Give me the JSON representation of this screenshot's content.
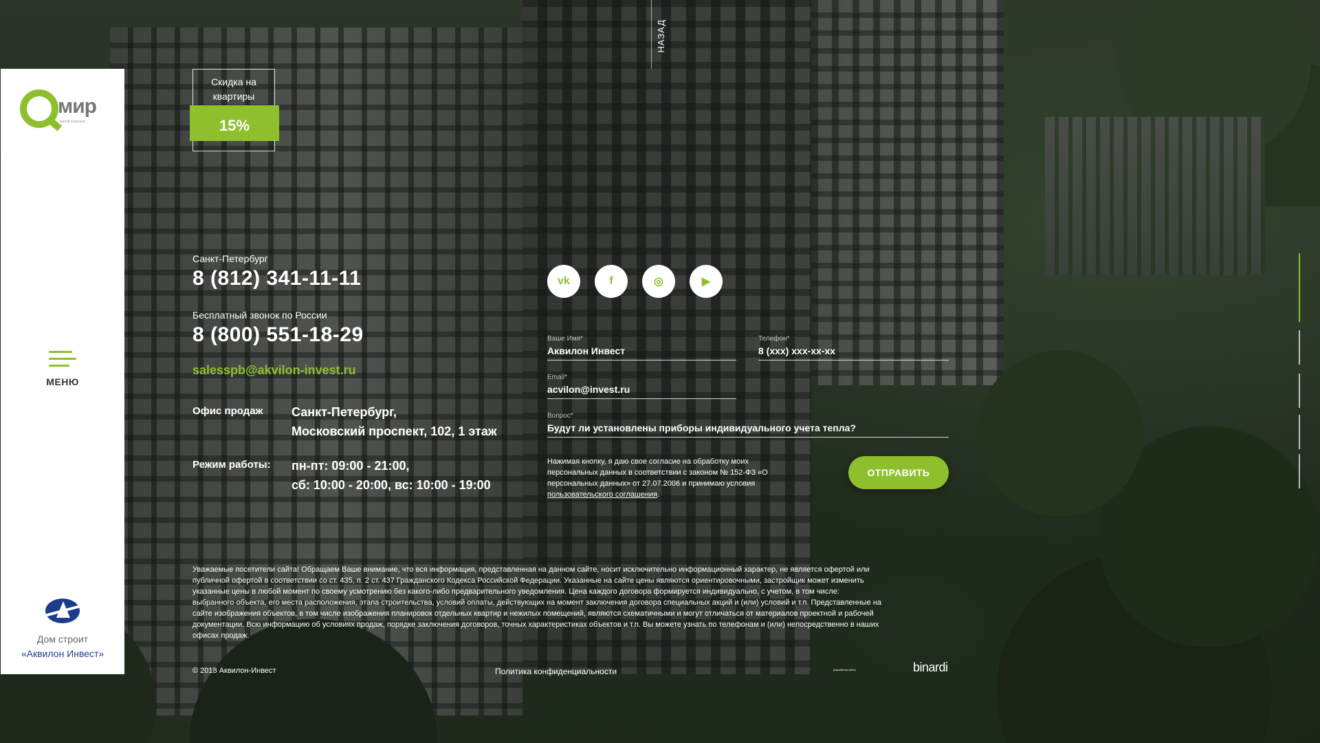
{
  "brand": {
    "logo_text": "мир",
    "logo_subtitle": "жилой комплекс"
  },
  "colors": {
    "accent": "#8ec02e",
    "sidebar_bg": "#ffffff",
    "builder_blue": "#1e3c8c"
  },
  "sidebar": {
    "menu_label": "МЕНЮ",
    "builder_line1": "Дом строит",
    "builder_line2": "«Аквилон Инвест»"
  },
  "discount": {
    "label": "Скидка на квартиры",
    "value": "15%"
  },
  "nav": {
    "back_label": "НАЗАД"
  },
  "contacts": {
    "city_label": "Санкт-Петербург",
    "phone_city": "8 (812) 341-11-11",
    "free_call_label": "Бесплатный звонок по России",
    "phone_free": "8 (800) 551-18-29",
    "email": "salesspb@akvilon-invest.ru",
    "office_label": "Офис продаж",
    "office_line1": "Санкт-Петербург,",
    "office_line2": "Московский проспект, 102, 1 этаж",
    "hours_label": "Режим работы:",
    "hours_line1": "пн-пт: 09:00 - 21:00,",
    "hours_line2": "сб: 10:00 - 20:00, вс: 10:00 - 19:00"
  },
  "social": [
    {
      "icon": "vk-icon",
      "glyph": "vk"
    },
    {
      "icon": "facebook-icon",
      "glyph": "f"
    },
    {
      "icon": "instagram-icon",
      "glyph": "◎"
    },
    {
      "icon": "youtube-icon",
      "glyph": "▶"
    }
  ],
  "form": {
    "name_label": "Ваше Имя*",
    "name_value": "Аквилон Инвест",
    "phone_label": "Телефон*",
    "phone_value": "8 (xxx) xxx-xx-xx",
    "email_label": "Email*",
    "email_value": "acvilon@invest.ru",
    "question_label": "Вопрос*",
    "question_value": "Будут ли установлены приборы индивидуального учета тепла?",
    "consent_text": "Нажимая кнопку, я даю свое согласие на обработку моих персональных данных в соответствии с законом № 152-ФЗ «О персональных данных» от 27.07.2006 и принимаю условия ",
    "consent_link": "пользовательского соглашения",
    "consent_tail": ".",
    "submit_label": "ОТПРАВИТЬ"
  },
  "footer": {
    "disclaimer": "Уважаемые посетители сайта! Обращаем Ваше внимание, что вся информация, представленная на данном сайте, носит исключительно информационный характер, не является офертой или публичной офертой в соответствии со ст. 435, п. 2 ст. 437 Гражданского Кодекса Российской Федерации. Указанные на сайте цены являются ориентировочными, застройщик может изменить указанные цены в любой момент по своему усмотрению без какого-либо предварительного уведомления. Цена каждого договора формируется индивидуально, с учетом, в том числе: выбранного объекта, его места расположения, этапа строительства, условий оплаты, действующих на момент заключения договора специальных акций и (или) условий и т.п. Представленные на сайте изображения объектов, в том числе изображения планировок отдельных квартир и нежилых помещений, являются схематичными и могут отличаться от материалов проектной и рабочей документации. Всю информацию об условиях продаж, порядке заключения договоров, точных характеристиках объектов и т.п. Вы можете узнать по телефонам и (или) непосредственно в наших офисах продаж.",
    "copyright": "© 2018 Аквилон-Инвест",
    "privacy": "Политика конфиденциальности",
    "dev_small": "разработка сайта",
    "dev_brand": "binardi"
  }
}
